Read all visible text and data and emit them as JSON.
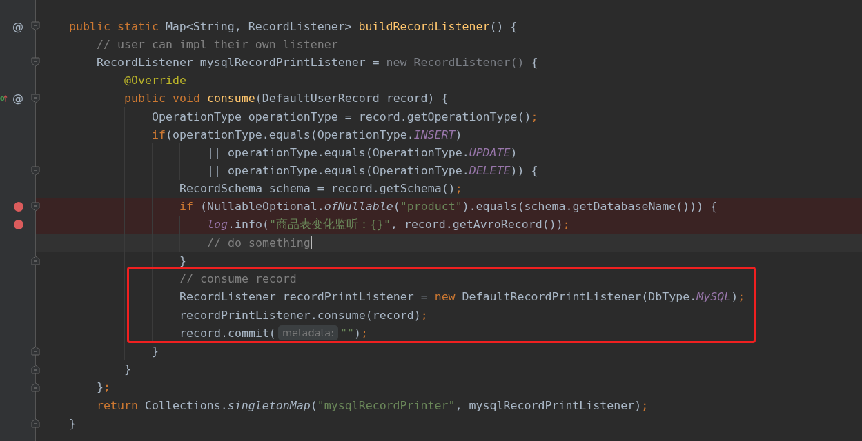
{
  "editor": {
    "lines": [
      {
        "gutter": [
          {
            "kind": "at",
            "text": "@"
          }
        ],
        "fold_open": true,
        "tokens": [
          {
            "kind": "kw",
            "text": "public static "
          },
          {
            "kind": "plain",
            "text": "Map<String, RecordListener> "
          },
          {
            "kind": "def",
            "text": "buildRecordListener"
          },
          {
            "kind": "plain",
            "text": "() {"
          }
        ]
      },
      {
        "tokens": [
          {
            "kind": "comment",
            "text": "    // user can impl their own listener"
          }
        ]
      },
      {
        "fold_open": true,
        "tokens": [
          {
            "kind": "plain",
            "text": "    RecordListener mysqlRecordPrintListener = "
          },
          {
            "kind": "dim",
            "text": "new RecordListener()"
          },
          {
            "kind": "plain",
            "text": " {"
          }
        ]
      },
      {
        "tokens": [
          {
            "kind": "annotation",
            "text": "        @Override"
          }
        ]
      },
      {
        "gutter": [
          {
            "kind": "implements"
          },
          {
            "kind": "at",
            "text": "@"
          }
        ],
        "fold_open": true,
        "tokens": [
          {
            "kind": "kw",
            "text": "        public void "
          },
          {
            "kind": "def",
            "text": "consume"
          },
          {
            "kind": "plain",
            "text": "(DefaultUserRecord record) {"
          }
        ]
      },
      {
        "tokens": [
          {
            "kind": "plain",
            "text": "            OperationType operationType = record.getOperationType()"
          },
          {
            "kind": "kw",
            "text": ";"
          }
        ]
      },
      {
        "tokens": [
          {
            "kind": "kw",
            "text": "            if"
          },
          {
            "kind": "plain",
            "text": "(operationType.equals(OperationType."
          },
          {
            "kind": "const",
            "text": "INSERT"
          },
          {
            "kind": "plain",
            "text": ")"
          }
        ]
      },
      {
        "tokens": [
          {
            "kind": "plain",
            "text": "                    || operationType.equals(OperationType."
          },
          {
            "kind": "const",
            "text": "UPDATE"
          },
          {
            "kind": "plain",
            "text": ")"
          }
        ]
      },
      {
        "fold_open": true,
        "tokens": [
          {
            "kind": "plain",
            "text": "                    || operationType.equals(OperationType."
          },
          {
            "kind": "const",
            "text": "DELETE"
          },
          {
            "kind": "plain",
            "text": ")) {"
          }
        ]
      },
      {
        "tokens": [
          {
            "kind": "plain",
            "text": "                RecordSchema schema = record.getSchema()"
          },
          {
            "kind": "kw",
            "text": ";"
          }
        ]
      },
      {
        "breakpoint": true,
        "fold_open": true,
        "tokens": [
          {
            "kind": "kw",
            "text": "                if "
          },
          {
            "kind": "plain",
            "text": "(NullableOptional."
          },
          {
            "kind": "static",
            "text": "ofNullable"
          },
          {
            "kind": "plain",
            "text": "("
          },
          {
            "kind": "str",
            "text": "\"product\""
          },
          {
            "kind": "plain",
            "text": ").equals(schema.getDatabaseName())) {"
          }
        ]
      },
      {
        "breakpoint": true,
        "tokens": [
          {
            "kind": "const",
            "text": "                    log"
          },
          {
            "kind": "plain",
            "text": ".info("
          },
          {
            "kind": "str",
            "text": "\"商品表变化监听：{}\""
          },
          {
            "kind": "plain",
            "text": ", record.getAvroRecord())"
          },
          {
            "kind": "kw",
            "text": ";"
          }
        ]
      },
      {
        "current": true,
        "tokens": [
          {
            "kind": "comment",
            "text": "                    // do something"
          }
        ]
      },
      {
        "fold_close": true,
        "tokens": [
          {
            "kind": "plain",
            "text": "                }"
          }
        ]
      },
      {
        "boxed": true,
        "tokens": [
          {
            "kind": "comment",
            "text": "                // consume record"
          }
        ]
      },
      {
        "boxed": true,
        "tokens": [
          {
            "kind": "plain",
            "text": "                RecordListener recordPrintListener = "
          },
          {
            "kind": "kw",
            "text": "new "
          },
          {
            "kind": "plain",
            "text": "DefaultRecordPrintListener(DbType."
          },
          {
            "kind": "const",
            "text": "MySQL"
          },
          {
            "kind": "plain",
            "text": ")"
          },
          {
            "kind": "kw",
            "text": ";"
          }
        ]
      },
      {
        "boxed": true,
        "tokens": [
          {
            "kind": "plain",
            "text": "                recordPrintListener.consume(record)"
          },
          {
            "kind": "kw",
            "text": ";"
          }
        ]
      },
      {
        "boxed": true,
        "tokens": [
          {
            "kind": "plain",
            "text": "                record.commit("
          },
          {
            "kind": "hint",
            "text": "metadata:"
          },
          {
            "kind": "str",
            "text": "\"\""
          },
          {
            "kind": "plain",
            "text": ")"
          },
          {
            "kind": "kw",
            "text": ";"
          }
        ]
      },
      {
        "fold_close": true,
        "tokens": [
          {
            "kind": "plain",
            "text": "            }"
          }
        ]
      },
      {
        "fold_close": true,
        "tokens": [
          {
            "kind": "plain",
            "text": "        }"
          }
        ]
      },
      {
        "fold_close": true,
        "tokens": [
          {
            "kind": "plain",
            "text": "    }"
          },
          {
            "kind": "kw",
            "text": ";"
          }
        ]
      },
      {
        "tokens": [
          {
            "kind": "kw",
            "text": "    return "
          },
          {
            "kind": "plain",
            "text": "Collections."
          },
          {
            "kind": "static",
            "text": "singletonMap"
          },
          {
            "kind": "plain",
            "text": "("
          },
          {
            "kind": "str",
            "text": "\"mysqlRecordPrinter\""
          },
          {
            "kind": "plain",
            "text": ", mysqlRecordPrintListener)"
          },
          {
            "kind": "kw",
            "text": ";"
          }
        ]
      },
      {
        "fold_close": true,
        "tokens": [
          {
            "kind": "plain",
            "text": "}"
          }
        ]
      }
    ]
  }
}
